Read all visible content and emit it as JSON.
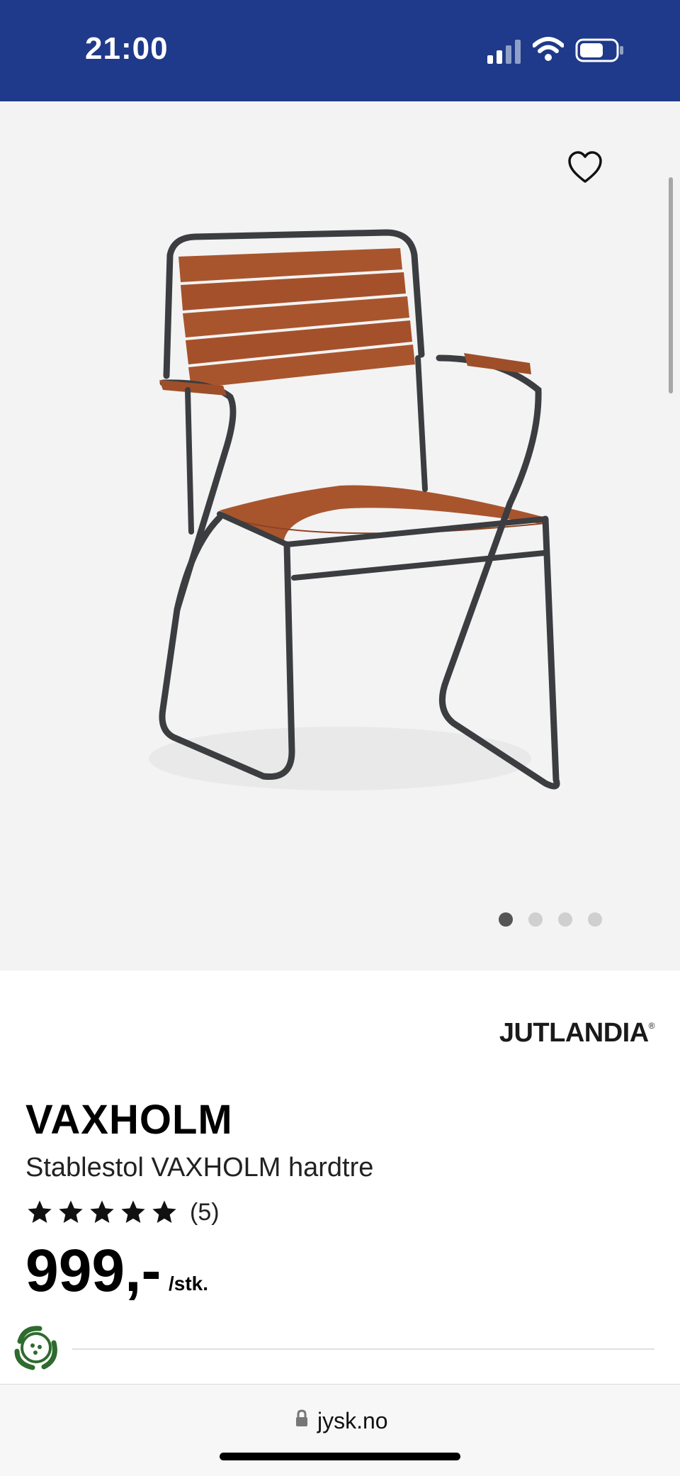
{
  "status_bar": {
    "time": "21:00",
    "battery_icon": "battery-icon",
    "wifi_icon": "wifi-icon",
    "signal_icon": "signal-icon"
  },
  "gallery": {
    "dots_count": 4,
    "active_dot": 1
  },
  "brand": {
    "name": "JUTLANDIA",
    "mark": "®"
  },
  "product": {
    "name": "VAXHOLM",
    "description": "Stablestol VAXHOLM hardtre",
    "rating_stars": 5,
    "rating_count": "(5)",
    "price": "999,-",
    "unit": "/stk."
  },
  "browser": {
    "url": "jysk.no"
  },
  "colors": {
    "header_blue": "#1f3a8a",
    "image_bg": "#f3f3f3",
    "wood": "#a8552e",
    "frame": "#3b3d40"
  }
}
